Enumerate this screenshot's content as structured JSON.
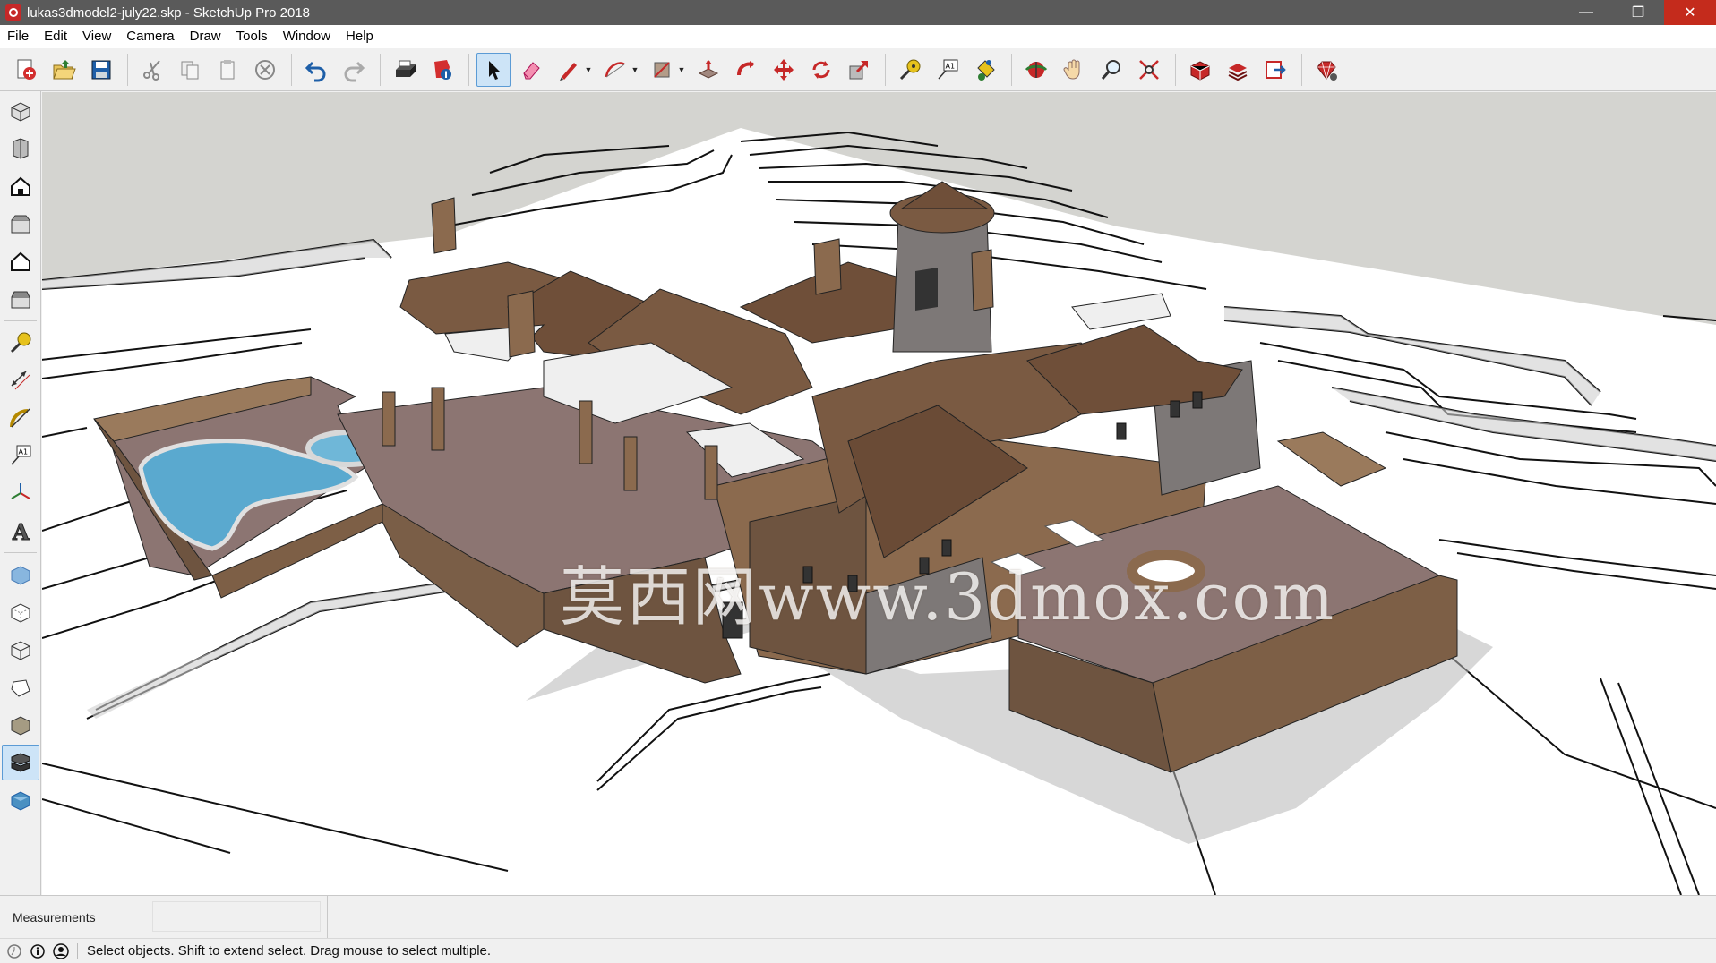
{
  "window": {
    "title": "lukas3dmodel2-july22.skp - SketchUp Pro 2018",
    "controls": {
      "minimize": "—",
      "restore": "❐",
      "close": "✕"
    }
  },
  "menubar": [
    "File",
    "Edit",
    "View",
    "Camera",
    "Draw",
    "Tools",
    "Window",
    "Help"
  ],
  "toolbar": {
    "tools": [
      {
        "name": "new-icon"
      },
      {
        "name": "open-icon"
      },
      {
        "name": "save-icon"
      },
      {
        "name": "cut-icon"
      },
      {
        "name": "copy-icon"
      },
      {
        "name": "paste-icon"
      },
      {
        "name": "erase-icon"
      },
      {
        "name": "undo-icon"
      },
      {
        "name": "redo-icon"
      },
      {
        "name": "print-icon"
      },
      {
        "name": "model-info-icon"
      },
      {
        "name": "select-icon",
        "active": true
      },
      {
        "name": "eraser-icon"
      },
      {
        "name": "line-icon"
      },
      {
        "name": "arc-icon"
      },
      {
        "name": "rectangle-icon"
      },
      {
        "name": "push-pull-icon"
      },
      {
        "name": "follow-me-icon"
      },
      {
        "name": "move-icon"
      },
      {
        "name": "rotate-icon"
      },
      {
        "name": "scale-icon"
      },
      {
        "name": "tape-measure-icon"
      },
      {
        "name": "text-icon"
      },
      {
        "name": "paint-bucket-icon"
      },
      {
        "name": "orbit-icon"
      },
      {
        "name": "pan-icon"
      },
      {
        "name": "zoom-icon"
      },
      {
        "name": "zoom-extents-icon"
      },
      {
        "name": "3d-warehouse-icon"
      },
      {
        "name": "extension-warehouse-icon"
      },
      {
        "name": "send-to-layout-icon"
      },
      {
        "name": "extension-manager-icon"
      }
    ],
    "text_tool_glyph": "A1"
  },
  "left_toolbar": {
    "tools": [
      "iso-view-icon",
      "top-view-icon",
      "front-view-icon",
      "right-view-icon",
      "back-view-icon",
      "left-view-icon",
      "tape-measure-icon",
      "dimension-icon",
      "protractor-icon",
      "text-icon",
      "axes-icon",
      "3d-text-icon",
      "xray-icon",
      "back-edges-icon",
      "wireframe-icon",
      "hidden-line-icon",
      "shaded-icon",
      "shaded-textures-icon",
      "monochrome-icon"
    ],
    "text_tool_glyph": "A1",
    "text3d_glyph": "A",
    "active": "shaded-textures-icon"
  },
  "viewport": {
    "watermark": "莫西网www.3dmox.com",
    "colors": {
      "sky": "#d4d4d0",
      "ground": "#ffffff",
      "terrain_edge": "#111111",
      "wall": "#8b6a4e",
      "roof": "#7a5a42",
      "deck": "#8c7572",
      "pool": "#5aa9cf",
      "stone": "#7d7877"
    }
  },
  "measurements": {
    "label": "Measurements",
    "value": ""
  },
  "status": {
    "icons": [
      "geo-location-icon",
      "credits-icon",
      "user-icon"
    ],
    "message": "Select objects. Shift to extend select. Drag mouse to select multiple."
  }
}
